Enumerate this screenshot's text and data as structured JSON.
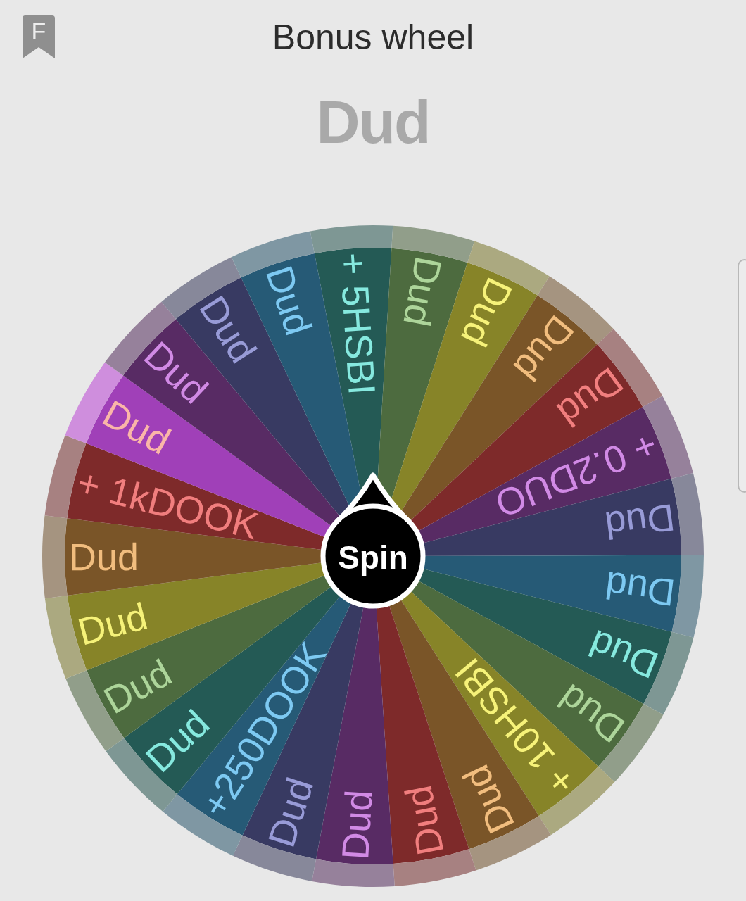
{
  "header": {
    "badge_letter": "F",
    "title": "Bonus wheel"
  },
  "result": "Dud",
  "wheel": {
    "spin_label": "Spin",
    "segments": [
      {
        "label": "+ 5HSBI",
        "color": "#245a55",
        "selected": false
      },
      {
        "label": "Dud",
        "color": "#4d6b3f",
        "selected": false
      },
      {
        "label": "Dud",
        "color": "#878428",
        "selected": false
      },
      {
        "label": "Dud",
        "color": "#7a5528",
        "selected": false
      },
      {
        "label": "Dud",
        "color": "#7e2a2a",
        "selected": false
      },
      {
        "label": "+ 0.2DUO",
        "color": "#582b64",
        "selected": false
      },
      {
        "label": "Dud",
        "color": "#383a62",
        "selected": false
      },
      {
        "label": "Dud",
        "color": "#265a76",
        "selected": false
      },
      {
        "label": "Dud",
        "color": "#245a55",
        "selected": false
      },
      {
        "label": "Dud",
        "color": "#4d6b3f",
        "selected": false
      },
      {
        "label": "+ 10HSBI",
        "color": "#878428",
        "selected": false
      },
      {
        "label": "Dud",
        "color": "#7a5528",
        "selected": false
      },
      {
        "label": "Dud",
        "color": "#7e2a2a",
        "selected": false
      },
      {
        "label": "Dud",
        "color": "#582b64",
        "selected": false
      },
      {
        "label": "Dud",
        "color": "#383a62",
        "selected": false
      },
      {
        "label": "+250DOOK",
        "color": "#265a76",
        "selected": false
      },
      {
        "label": "Dud",
        "color": "#245a55",
        "selected": false
      },
      {
        "label": "Dud",
        "color": "#4d6b3f",
        "selected": false
      },
      {
        "label": "Dud",
        "color": "#878428",
        "selected": false
      },
      {
        "label": "Dud",
        "color": "#7a5528",
        "selected": false
      },
      {
        "label": "+ 1kDOOK",
        "color": "#7e2a2a",
        "selected": false
      },
      {
        "label": "Dud",
        "color": "#a040b8",
        "selected": true
      },
      {
        "label": "Dud",
        "color": "#582b64",
        "selected": false
      },
      {
        "label": "Dud",
        "color": "#383a62",
        "selected": false
      },
      {
        "label": "Dud",
        "color": "#265a76",
        "selected": false
      }
    ]
  }
}
